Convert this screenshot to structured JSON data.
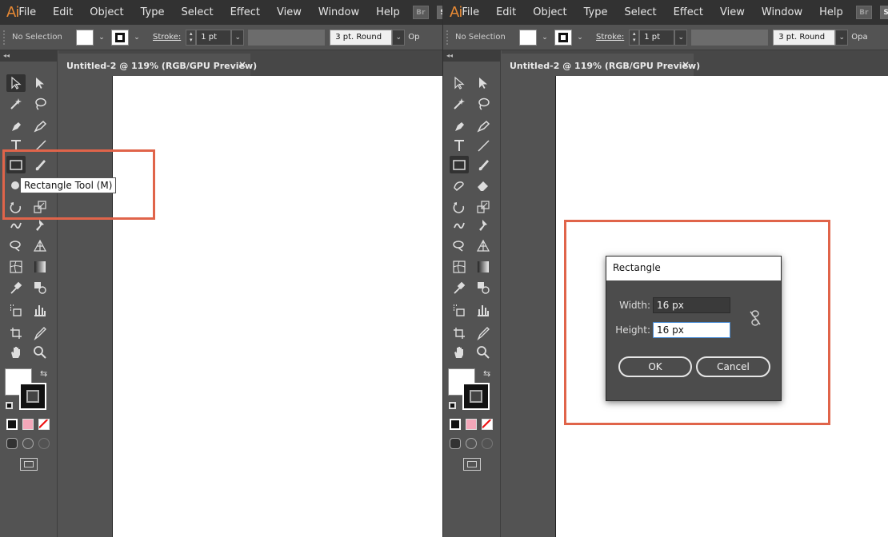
{
  "app": {
    "logo": "Ai"
  },
  "menu": [
    "File",
    "Edit",
    "Object",
    "Type",
    "Select",
    "Effect",
    "View",
    "Window",
    "Help"
  ],
  "bridge": {
    "br": "Br",
    "st": "St"
  },
  "control": {
    "selection": "No Selection",
    "stroke_label": "Stroke:",
    "stroke_value": "1 pt",
    "brush": "3 pt. Round",
    "opacity_left": "Op",
    "opacity_right": "Opa"
  },
  "document": {
    "tab_title": "Untitled-2 @ 119% (RGB/GPU Preview)",
    "close": "×"
  },
  "toolbox": {
    "collapse": "◂◂"
  },
  "tooltip": {
    "text": "Rectangle Tool (M)"
  },
  "dialog": {
    "title": "Rectangle",
    "width_label": "Width:",
    "width_value": "16 px",
    "height_label": "Height:",
    "height_value": "16 px",
    "ok": "OK",
    "cancel": "Cancel"
  },
  "colors": {
    "highlight": "#e0644a",
    "accent": "#e98a34"
  }
}
